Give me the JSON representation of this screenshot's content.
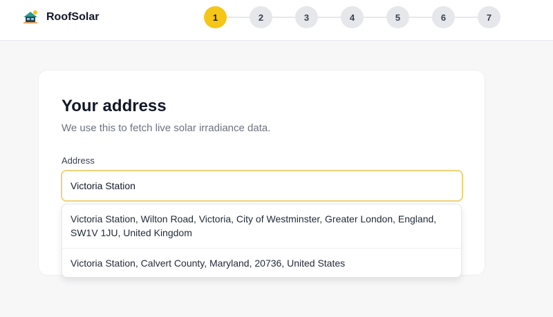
{
  "header": {
    "brand": "RoofSolar",
    "logo_icon": "house-solar-logo-icon"
  },
  "stepper": {
    "current": 1,
    "steps": [
      "1",
      "2",
      "3",
      "4",
      "5",
      "6",
      "7"
    ],
    "active_color": "#f5c518"
  },
  "form": {
    "title": "Your address",
    "subtitle": "We use this to fetch live solar irradiance data.",
    "address_label": "Address",
    "address_value": "Victoria Station",
    "focus_color": "#f1d077"
  },
  "suggestions": [
    "Victoria Station, Wilton Road, Victoria, City of Westminster, Greater London, England, SW1V 1JU, United Kingdom",
    "Victoria Station, Calvert County, Maryland, 20736, United States"
  ]
}
